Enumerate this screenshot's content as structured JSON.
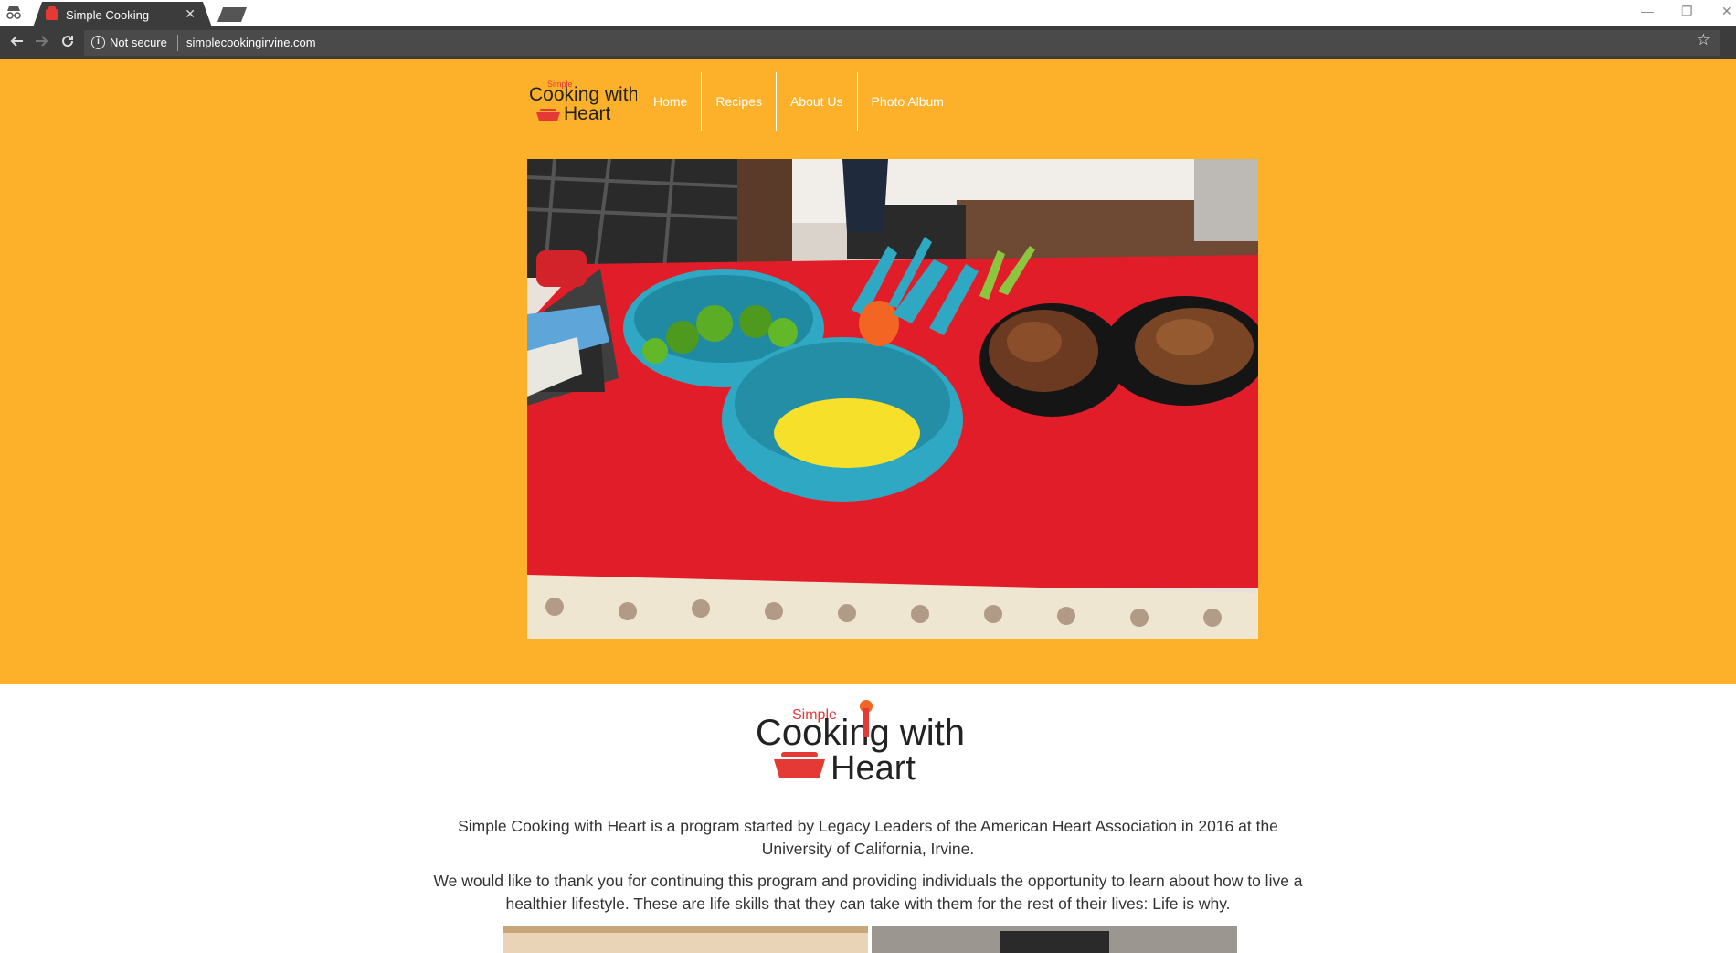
{
  "browser": {
    "tab_title": "Simple Cooking",
    "security_label": "Not secure",
    "url": "simplecookingirvine.com"
  },
  "site": {
    "logo": {
      "line1": "Simple",
      "line2": "Cooking with",
      "line3": "Heart"
    },
    "nav": [
      "Home",
      "Recipes",
      "About Us",
      "Photo Album"
    ],
    "paragraph1": "Simple Cooking with Heart is a program started by Legacy Leaders of the American Heart Association in 2016 at the University of California, Irvine.",
    "paragraph2": "We would like to thank you for continuing this program and providing individuals the opportunity to learn about how to live a healthier lifestyle. These are life skills that they can take with them for the rest of their lives: Life is why."
  },
  "colors": {
    "brand_orange": "#fdb02a",
    "logo_red": "#e53935",
    "tablecloth_red": "#e11d2a",
    "bowl_teal": "#2fa9c3"
  },
  "icons": [
    "incognito-icon",
    "tab-favicon",
    "close-icon",
    "back-icon",
    "forward-icon",
    "reload-icon",
    "info-icon",
    "star-icon"
  ]
}
